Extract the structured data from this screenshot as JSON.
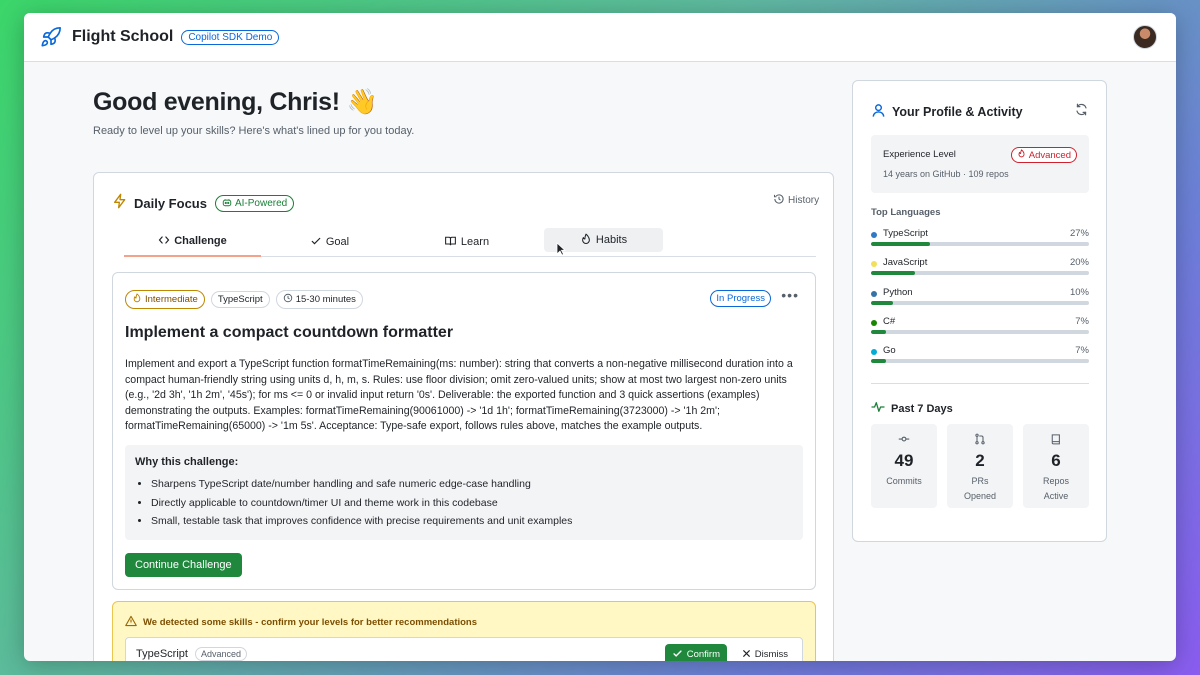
{
  "app": {
    "title": "Flight School",
    "badge": "Copilot SDK Demo"
  },
  "greeting": {
    "title": "Good evening, Chris! 👋",
    "subtitle": "Ready to level up your skills? Here's what's lined up for you today."
  },
  "focus": {
    "title": "Daily Focus",
    "ai_badge": "AI-Powered",
    "history_label": "History",
    "tabs": [
      {
        "label": "Challenge",
        "icon": "code-icon"
      },
      {
        "label": "Goal",
        "icon": "check-icon"
      },
      {
        "label": "Learn",
        "icon": "book-icon"
      },
      {
        "label": "Habits",
        "icon": "flame-icon"
      }
    ]
  },
  "challenge": {
    "level": "Intermediate",
    "language": "TypeScript",
    "duration": "15-30 minutes",
    "status": "In Progress",
    "title": "Implement a compact countdown formatter",
    "description": "Implement and export a TypeScript function formatTimeRemaining(ms: number): string that converts a non-negative millisecond duration into a compact human-friendly string using units d, h, m, s. Rules: use floor division; omit zero-valued units; show at most two largest non-zero units (e.g., '2d 3h', '1h 2m', '45s'); for ms <= 0 or invalid input return '0s'. Deliverable: the exported function and 3 quick assertions (examples) demonstrating the outputs. Examples: formatTimeRemaining(90061000) -> '1d 1h'; formatTimeRemaining(3723000) -> '1h 2m'; formatTimeRemaining(65000) -> '1m 5s'. Acceptance: Type-safe export, follows rules above, matches the example outputs.",
    "why_title": "Why this challenge:",
    "why_items": [
      "Sharpens TypeScript date/number handling and safe numeric edge-case handling",
      "Directly applicable to countdown/timer UI and theme work in this codebase",
      "Small, testable task that improves confidence with precise requirements and unit examples"
    ],
    "continue_label": "Continue Challenge"
  },
  "detect": {
    "message": "We detected some skills - confirm your levels for better recommendations",
    "language": "TypeScript",
    "level": "Advanced",
    "confirm_label": "Confirm",
    "dismiss_label": "Dismiss"
  },
  "profile": {
    "title": "Your Profile & Activity",
    "experience_label": "Experience Level",
    "experience_badge": "Advanced",
    "experience_sub": "14 years on GitHub · 109 repos",
    "languages_title": "Top Languages",
    "languages": [
      {
        "name": "TypeScript",
        "pct": "27%",
        "value": 27,
        "color": "#3178c6"
      },
      {
        "name": "JavaScript",
        "pct": "20%",
        "value": 20,
        "color": "#f1e05a"
      },
      {
        "name": "Python",
        "pct": "10%",
        "value": 10,
        "color": "#3572A5"
      },
      {
        "name": "C#",
        "pct": "7%",
        "value": 7,
        "color": "#178600"
      },
      {
        "name": "Go",
        "pct": "7%",
        "value": 7,
        "color": "#00ADD8"
      }
    ],
    "past_title": "Past 7 Days",
    "stats": [
      {
        "value": "49",
        "label": "Commits",
        "icon": "commit-icon"
      },
      {
        "value": "2",
        "label": "PRs Opened",
        "icon": "pull-request-icon"
      },
      {
        "value": "6",
        "label": "Repos Active",
        "icon": "repo-icon"
      }
    ]
  }
}
